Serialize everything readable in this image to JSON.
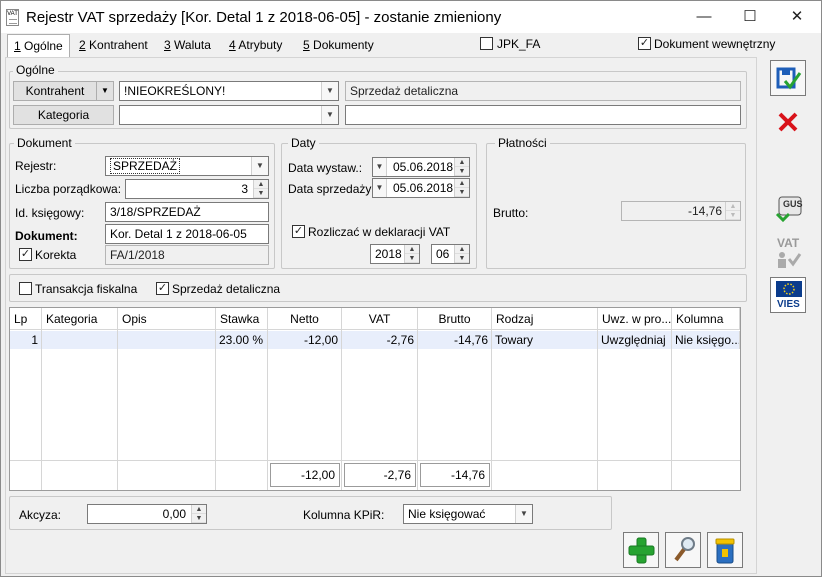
{
  "window": {
    "icon_text": "VAT",
    "title": "Rejestr VAT sprzedaży [Kor. Detal 1  z 2018-06-05] - zostanie zmieniony",
    "minimize": "—",
    "maximize": "☐",
    "close": "✕"
  },
  "tabs": [
    {
      "key": "1",
      "label": " Ogólne"
    },
    {
      "key": "2",
      "label": " Kontrahent"
    },
    {
      "key": "3",
      "label": " Waluta"
    },
    {
      "key": "4",
      "label": " Atrybuty"
    },
    {
      "key": "5",
      "label": " Dokumenty"
    }
  ],
  "flags": {
    "jpk_fa_label": "JPK_FA",
    "jpk_fa_checked": false,
    "dokument_wewnetrzny_label": "Dokument wewnętrzny",
    "dokument_wewnetrzny_checked": true
  },
  "ogolne": {
    "title": "Ogólne",
    "kontrahent_button": "Kontrahent",
    "kontrahent_value": "!NIEOKREŚLONY!",
    "kontrahent_name": "Sprzedaż detaliczna",
    "kategoria_button": "Kategoria",
    "kategoria_value": "",
    "kategoria_desc": ""
  },
  "dokument": {
    "title": "Dokument",
    "rejestr_label": "Rejestr:",
    "rejestr_value": "SPRZEDAŻ",
    "lp_label": "Liczba porządkowa:",
    "lp_value": "3",
    "id_label": "Id. księgowy:",
    "id_value": "3/18/SPRZEDAŻ",
    "dokument_label": "Dokument:",
    "dokument_value": "Kor. Detal 1  z 2018-06-05",
    "korekta_label": "Korekta",
    "korekta_checked": true,
    "korekta_value": "FA/1/2018"
  },
  "daty": {
    "title": "Daty",
    "wystaw_label": "Data wystaw.:",
    "wystaw_value": "05.06.2018",
    "sprzedazy_label": "Data sprzedaży:",
    "sprzedazy_value": "05.06.2018",
    "rozliczac_label": "Rozliczać w deklaracji VAT",
    "rozliczac_checked": true,
    "rok": "2018",
    "miesiac": "06"
  },
  "platnosci": {
    "title": "Płatności",
    "brutto_label": "Brutto:",
    "brutto_value": "-14,76"
  },
  "options": {
    "transakcja_fiskalna_label": "Transakcja fiskalna",
    "transakcja_fiskalna_checked": false,
    "sprzedaz_detaliczna_label": "Sprzedaż detaliczna",
    "sprzedaz_detaliczna_checked": true
  },
  "grid": {
    "headers": [
      "Lp",
      "Kategoria",
      "Opis",
      "Stawka",
      "Netto",
      "VAT",
      "Brutto",
      "Rodzaj",
      "Uwz. w pro...",
      "Kolumna"
    ],
    "rows": [
      [
        "1",
        "",
        "",
        "23.00 %",
        "-12,00",
        "-2,76",
        "-14,76",
        "Towary",
        "Uwzględniaj",
        "Nie księgo..."
      ]
    ],
    "totals": {
      "netto": "-12,00",
      "vat": "-2,76",
      "brutto": "-14,76"
    }
  },
  "bottom": {
    "akcyza_label": "Akcyza:",
    "akcyza_value": "0,00",
    "kpir_label": "Kolumna KPiR:",
    "kpir_value": "Nie księgować"
  },
  "side": {
    "gus_text": "GUS",
    "vat_text": "VAT",
    "vies_text": "VIES"
  },
  "colors": {
    "selection_row": "#e8eefb",
    "save_icon": "#1e5eb8",
    "cancel_icon": "#d9121a",
    "add_icon": "#27a331",
    "vies_blue": "#0b3c8c",
    "vies_star": "#f6d21a"
  }
}
